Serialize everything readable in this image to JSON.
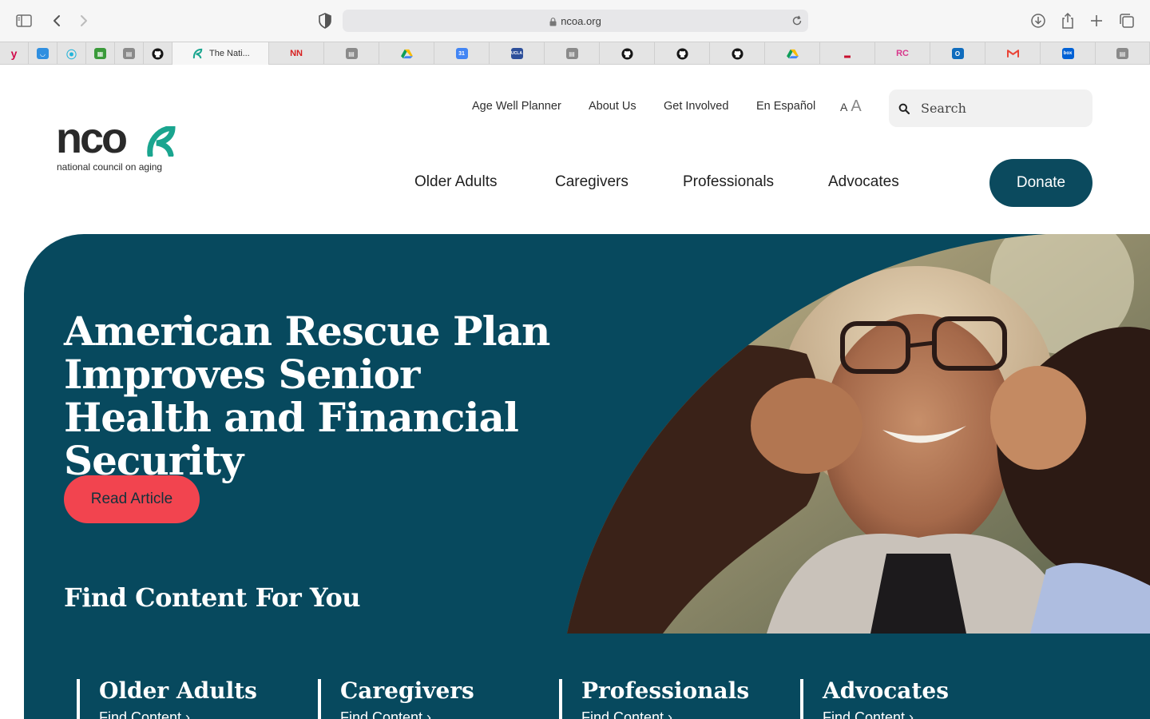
{
  "browser": {
    "url": "ncoa.org",
    "active_tab_title": "The Nati...",
    "icons": [
      "sidebar-icon",
      "back-arrow-icon",
      "forward-arrow-icon",
      "privacy-shield-icon",
      "lock-icon",
      "reload-icon",
      "download-icon",
      "share-icon",
      "new-tab-plus-icon",
      "tab-overview-icon"
    ]
  },
  "header": {
    "logo_word": "nco",
    "logo_tagline": "national council on aging",
    "utility_nav": [
      "Age Well Planner",
      "About Us",
      "Get Involved",
      "En Español"
    ],
    "font_size_small": "A",
    "font_size_large": "A",
    "search_placeholder": "Search",
    "main_nav": [
      "Older Adults",
      "Caregivers",
      "Professionals",
      "Advocates"
    ],
    "donate_label": "Donate"
  },
  "hero": {
    "title": "American Rescue Plan Improves Senior Health and Financial Security",
    "cta_label": "Read Article",
    "find_title": "Find Content For You",
    "categories": [
      {
        "title": "Older Adults",
        "link": "Find Content ›"
      },
      {
        "title": "Caregivers",
        "link": "Find Content ›"
      },
      {
        "title": "Professionals",
        "link": "Find Content ›"
      },
      {
        "title": "Advocates",
        "link": "Find Content ›"
      }
    ]
  },
  "colors": {
    "brand_teal_dark": "#07495e",
    "donate_bg": "#0b4a5e",
    "cta_red": "#f2444f",
    "logo_accent": "#1aa58f"
  }
}
